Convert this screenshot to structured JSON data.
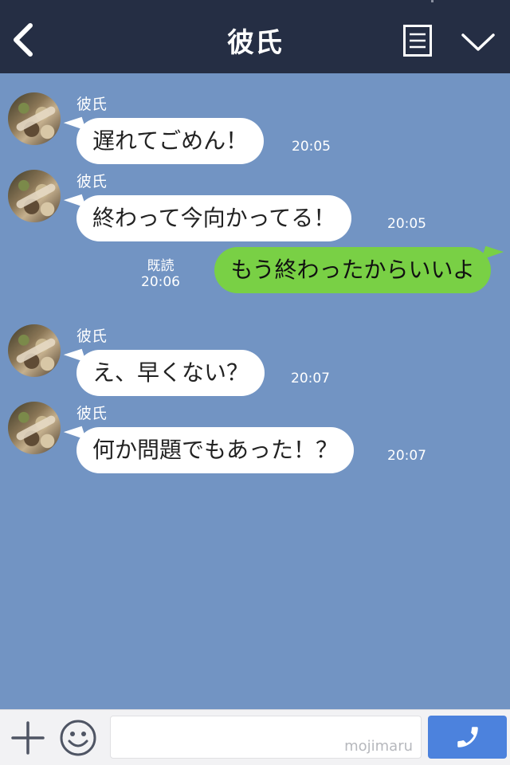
{
  "header": {
    "title": "彼氏"
  },
  "messages": [
    {
      "sender": "彼氏",
      "text": "遅れてごめん！",
      "time": "20:05"
    },
    {
      "sender": "彼氏",
      "text": "終わって今向かってる！",
      "time": "20:05"
    },
    {
      "text": "もう終わったからいいよ",
      "read": "既読",
      "time": "20:06"
    },
    {
      "sender": "彼氏",
      "text": "え、早くない？",
      "time": "20:07"
    },
    {
      "sender": "彼氏",
      "text": "何か問題でもあった！？",
      "time": "20:07"
    }
  ],
  "input": {
    "watermark": "mojimaru"
  },
  "colors": {
    "header_bg": "#252e44",
    "chat_bg": "#7294c3",
    "my_bubble": "#79d045",
    "call_button": "#4c82dd"
  },
  "icons": [
    "back-chevron-icon",
    "menu-icon",
    "chevron-down-icon",
    "plus-icon",
    "emoji-icon",
    "phone-icon"
  ]
}
